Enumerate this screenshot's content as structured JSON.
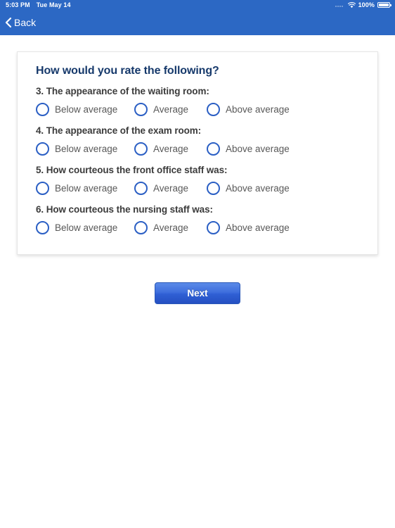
{
  "status_bar": {
    "time": "5:03 PM",
    "date": "Tue May 14",
    "battery_percent": "100%",
    "signal_icon": "signal-dots-icon",
    "wifi_icon": "wifi-icon",
    "battery_icon": "battery-full-icon"
  },
  "nav_bar": {
    "back_label": "Back",
    "back_icon": "chevron-left-icon"
  },
  "card": {
    "title": "How would you rate the following?",
    "questions": [
      {
        "text": "3. The appearance of the waiting room:",
        "options": [
          "Below average",
          "Average",
          "Above average"
        ]
      },
      {
        "text": "4. The appearance of the exam room:",
        "options": [
          "Below average",
          "Average",
          "Above average"
        ]
      },
      {
        "text": "5. How courteous the front office staff was:",
        "options": [
          "Below average",
          "Average",
          "Above average"
        ]
      },
      {
        "text": "6. How courteous the nursing staff was:",
        "options": [
          "Below average",
          "Average",
          "Above average"
        ]
      }
    ]
  },
  "footer": {
    "next_label": "Next"
  },
  "colors": {
    "nav_blue": "#2c68c4",
    "title_navy": "#16396b",
    "radio_blue": "#2b5fc4",
    "button_blue": "#3f6fdd",
    "question_text": "#3b3b3b",
    "option_text": "#585858"
  }
}
